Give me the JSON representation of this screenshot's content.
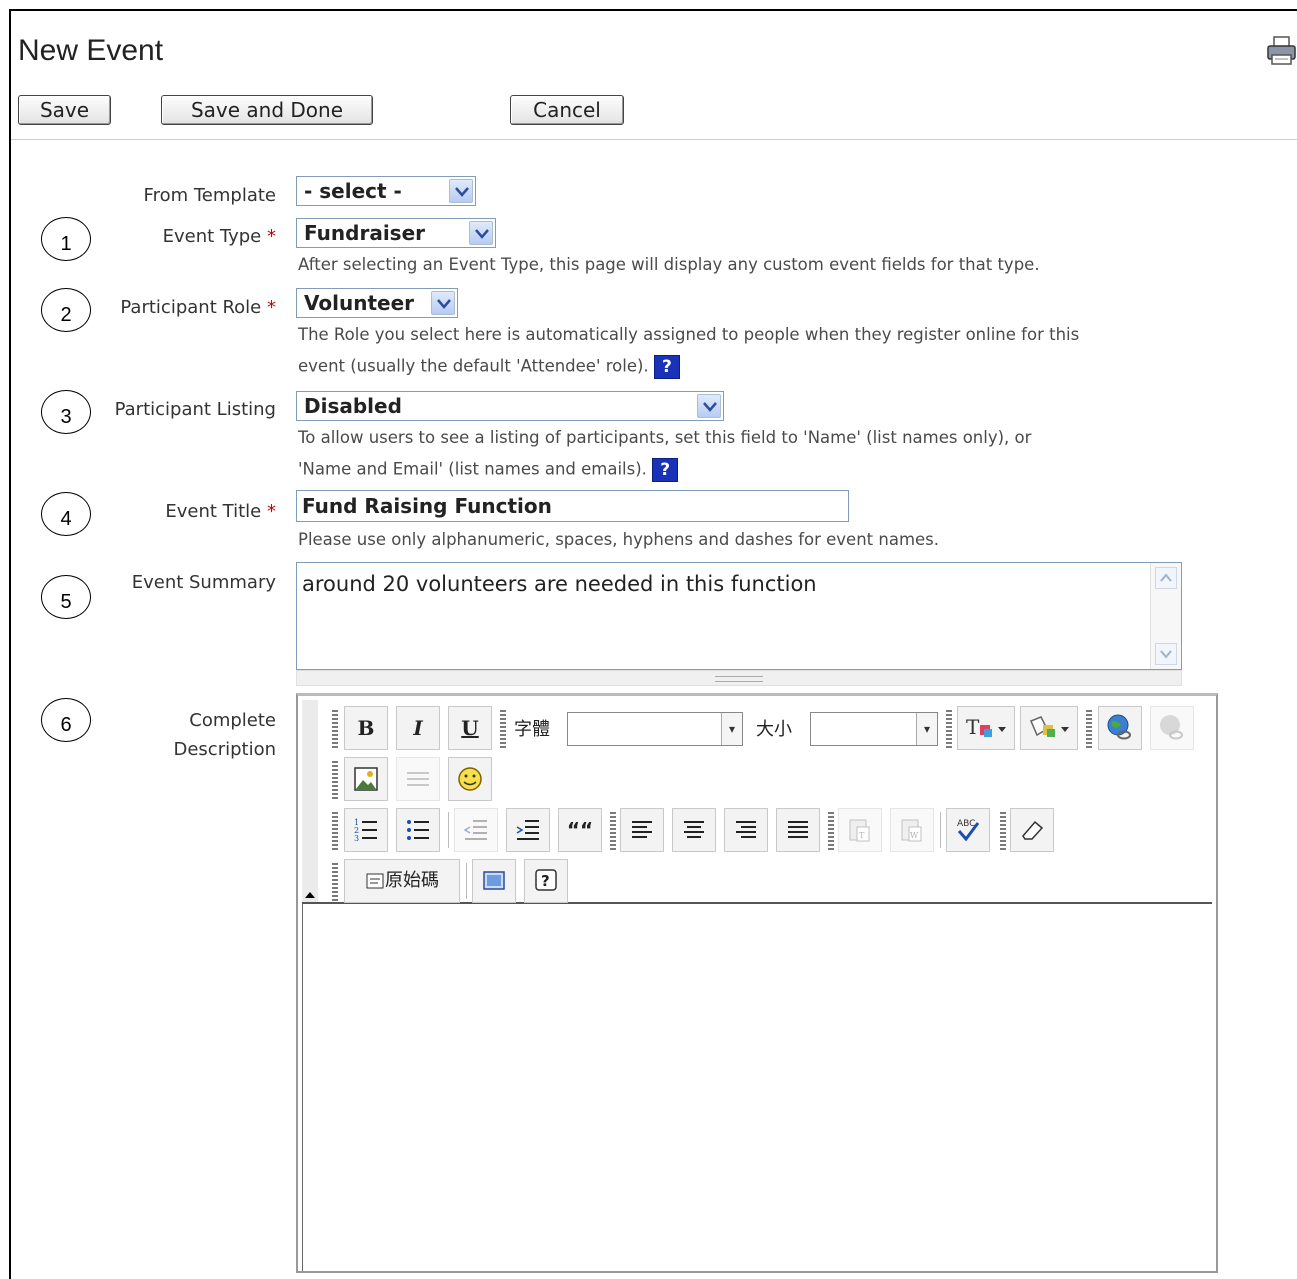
{
  "page": {
    "title": "New Event"
  },
  "buttons": {
    "save": "Save",
    "save_done": "Save and Done",
    "cancel": "Cancel"
  },
  "form": {
    "from_template": {
      "label": "From Template",
      "value": "- select -"
    },
    "event_type": {
      "label": "Event Type",
      "required": "*",
      "value": "Fundraiser",
      "help": "After selecting an Event Type, this page will display any custom event fields for that type."
    },
    "participant_role": {
      "label": "Participant Role",
      "required": "*",
      "value": "Volunteer",
      "help_line1": "The Role you select here is automatically assigned to people when they register online for this",
      "help_line2": "event (usually the default 'Attendee' role)."
    },
    "participant_listing": {
      "label": "Participant Listing",
      "value": "Disabled",
      "help_line1": "To allow users to see a listing of participants, set this field to 'Name' (list names only), or",
      "help_line2": "'Name and Email' (list names and emails)."
    },
    "event_title": {
      "label": "Event Title",
      "required": "*",
      "value": "Fund Raising Function",
      "help": "Please use only alphanumeric, spaces, hyphens and dashes for event names."
    },
    "event_summary": {
      "label": "Event Summary",
      "value": "around 20 volunteers are needed in this function"
    },
    "complete_description": {
      "label_line1": "Complete",
      "label_line2": "Description"
    }
  },
  "help_icon": "?",
  "annotations": [
    "1",
    "2",
    "3",
    "4",
    "5",
    "6"
  ],
  "editor_toolbar": {
    "bold": "B",
    "italic": "I",
    "underline": "U",
    "font_label": "字體",
    "size_label": "大小",
    "quote": "““",
    "source_label": "原始碼",
    "help": "?"
  },
  "colors": {
    "accent": "#1933b8",
    "required": "#cc0000",
    "border": "#7f9db9"
  }
}
